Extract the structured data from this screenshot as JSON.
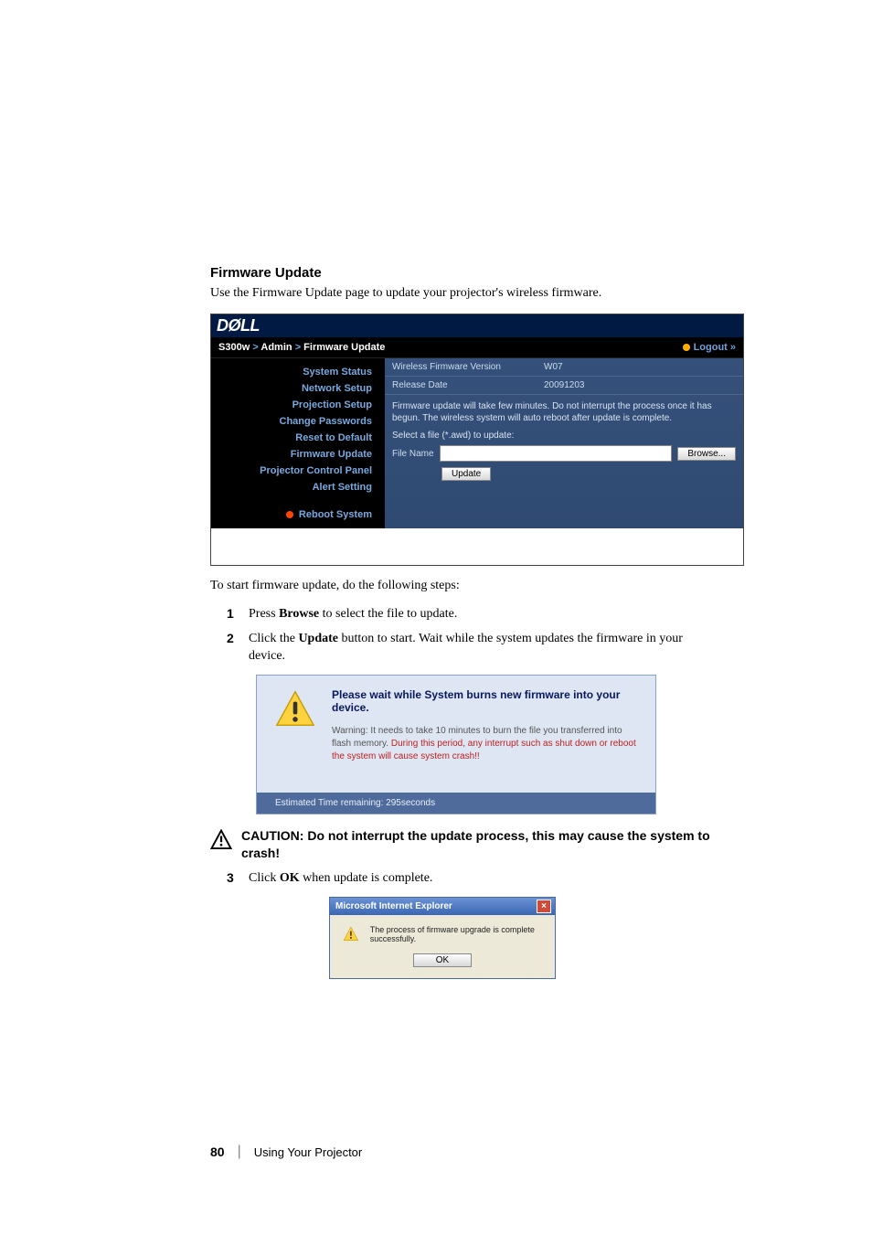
{
  "section": {
    "title": "Firmware Update"
  },
  "intro": "Use the Firmware Update page to update your projector's wireless firmware.",
  "admin": {
    "logo": "DØLL",
    "crumb1": "S300w",
    "crumb2": "Admin",
    "crumb3": "Firmware Update",
    "logout": "Logout »",
    "nav": {
      "system_status": "System Status",
      "network_setup": "Network Setup",
      "projection_setup": "Projection Setup",
      "change_passwords": "Change Passwords",
      "reset_to_default": "Reset to Default",
      "firmware_update": "Firmware Update",
      "projector_control_panel": "Projector Control Panel",
      "alert_setting": "Alert Setting",
      "reboot_system": "Reboot System"
    },
    "content": {
      "fw_ver_label": "Wireless Firmware Version",
      "fw_ver_value": "W07",
      "rel_date_label": "Release Date",
      "rel_date_value": "20091203",
      "msg1": "Firmware update will take few minutes. Do not interrupt the process once it has begun. The wireless system will auto reboot after update is complete.",
      "msg2": "Select a file (*.awd) to update:",
      "filename_label": "File Name",
      "browse_btn": "Browse...",
      "update_btn": "Update"
    }
  },
  "steps_intro": "To start firmware update, do the following steps:",
  "step1": {
    "num": "1",
    "pre": "Press ",
    "bold": "Browse",
    "post": " to select the file to update."
  },
  "step2": {
    "num": "2",
    "pre": "Click the ",
    "bold": "Update",
    "post": " button to start. Wait while the system updates the firmware in your device."
  },
  "progress": {
    "title": "Please wait while System burns new firmware into your device.",
    "warn_pre": "Warning: It needs to take 10 minutes to burn the file you transferred into flash memory.",
    "warn_red": "During this period, any interrupt such as shut down or reboot the system will cause system crash!!",
    "footer": "Estimated Time remaining: 295seconds"
  },
  "caution": {
    "label": "CAUTION: ",
    "text": "Do not interrupt the update process, this may cause the system to crash!"
  },
  "step3": {
    "num": "3",
    "pre": "Click ",
    "bold": "OK",
    "post": " when update is complete."
  },
  "dialog": {
    "title": "Microsoft Internet Explorer",
    "close": "×",
    "msg": "The process of firmware upgrade is complete successfully.",
    "ok": "OK"
  },
  "footer": {
    "page": "80",
    "label": "Using Your Projector"
  }
}
